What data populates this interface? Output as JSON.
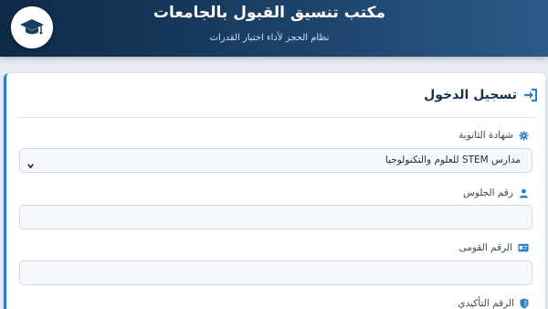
{
  "header": {
    "title": "مكتب تنسيق القبول بالجامعات",
    "subtitle": "نظام الحجز لأداء اختبار القدرات",
    "logo_icon": "graduation-cap-icon"
  },
  "login": {
    "title": "تسجيل الدخول",
    "title_icon": "sign-in-icon",
    "accent_color": "#2b7ec8"
  },
  "form": {
    "certificate": {
      "label": "شهادة الثانوية",
      "icon": "gear-icon",
      "selected": "مدارس STEM للعلوم والتكنولوجيا"
    },
    "seat_number": {
      "label": "رقم الجلوس",
      "icon": "user-icon",
      "value": ""
    },
    "national_id": {
      "label": "الرقم القومى",
      "icon": "id-card-icon",
      "value": ""
    },
    "confirmation_number": {
      "label": "الرقم التأكيدي",
      "icon": "shield-icon"
    }
  }
}
